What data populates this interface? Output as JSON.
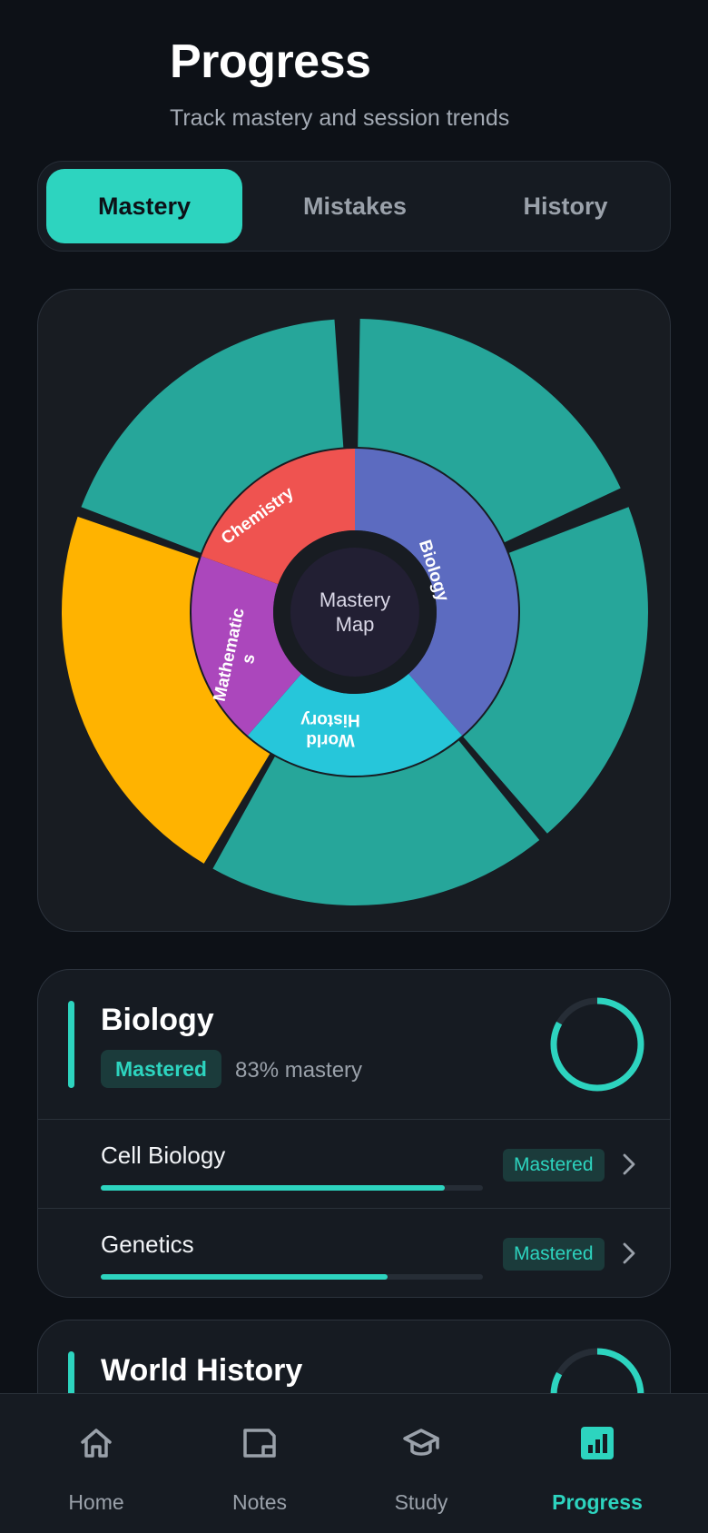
{
  "header": {
    "title": "Progress",
    "subtitle": "Track mastery and session trends"
  },
  "tabs": [
    {
      "label": "Mastery",
      "active": true
    },
    {
      "label": "Mistakes",
      "active": false
    },
    {
      "label": "History",
      "active": false
    }
  ],
  "chart_data": {
    "type": "sunburst",
    "center_label": [
      "Mastery",
      "Map"
    ],
    "inner_ring": [
      {
        "name": "Biology",
        "color": "#5c6bc0"
      },
      {
        "name": "World History",
        "color": "#26c6da"
      },
      {
        "name": "Mathematics",
        "color": "#ab47bc"
      },
      {
        "name": "Chemistry",
        "color": "#ef5350"
      }
    ],
    "outer_ring": [
      {
        "parent": "Biology",
        "color": "#26a69a"
      },
      {
        "parent": "Biology",
        "color": "#26a69a"
      },
      {
        "parent": "World History",
        "color": "#26a69a"
      },
      {
        "parent": "Mathematics",
        "color": "#ffb300"
      },
      {
        "parent": "Chemistry",
        "color": "#26a69a"
      }
    ]
  },
  "subjects": [
    {
      "name": "Biology",
      "badge": "Mastered",
      "mastery_text": "83% mastery",
      "mastery": 0.83,
      "topics": [
        {
          "name": "Cell Biology",
          "badge": "Mastered",
          "progress": 0.9
        },
        {
          "name": "Genetics",
          "badge": "Mastered",
          "progress": 0.75
        }
      ]
    },
    {
      "name": "World History",
      "mastery": 0.83
    }
  ],
  "nav": [
    {
      "label": "Home",
      "icon": "home-icon",
      "active": false
    },
    {
      "label": "Notes",
      "icon": "notes-icon",
      "active": false
    },
    {
      "label": "Study",
      "icon": "study-icon",
      "active": false
    },
    {
      "label": "Progress",
      "icon": "progress-icon",
      "active": true
    }
  ],
  "colors": {
    "accent": "#2dd4bf",
    "background": "#0d1117",
    "card": "#161b22"
  }
}
